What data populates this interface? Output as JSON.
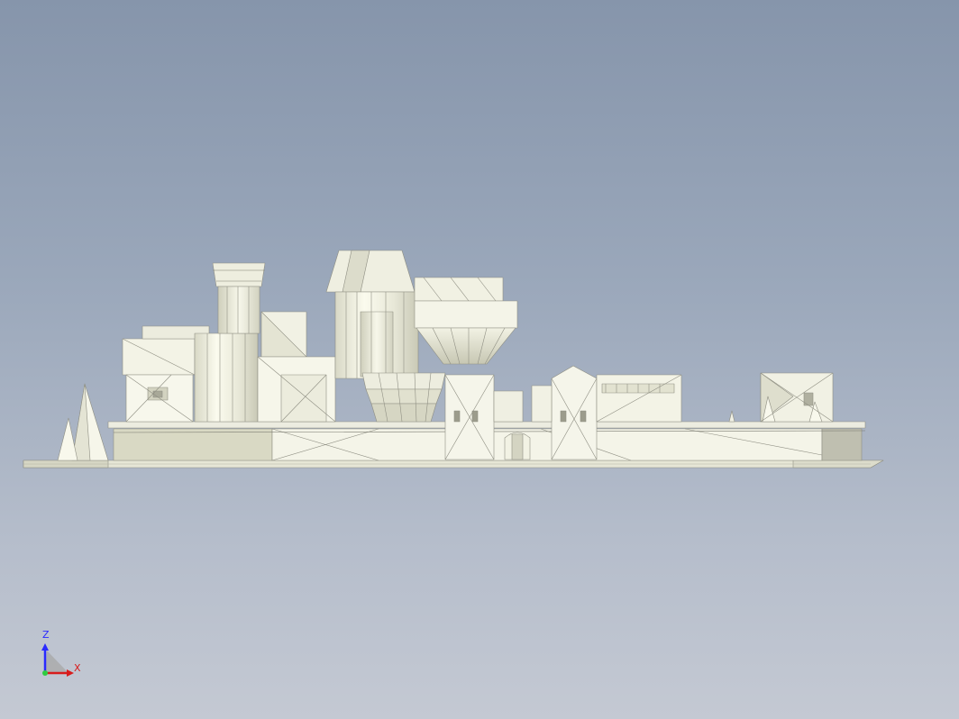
{
  "viewport": {
    "background_top": "#8695ab",
    "background_bottom": "#c4c9d3",
    "model_fill": "#f4f4e6",
    "model_shade": "#d9d9c8",
    "model_edge": "#8c8c80"
  },
  "triad": {
    "z_label": "Z",
    "x_label": "X",
    "z_color": "#2a2aff",
    "x_color": "#d81c1c",
    "origin_color": "#2ecc40"
  }
}
